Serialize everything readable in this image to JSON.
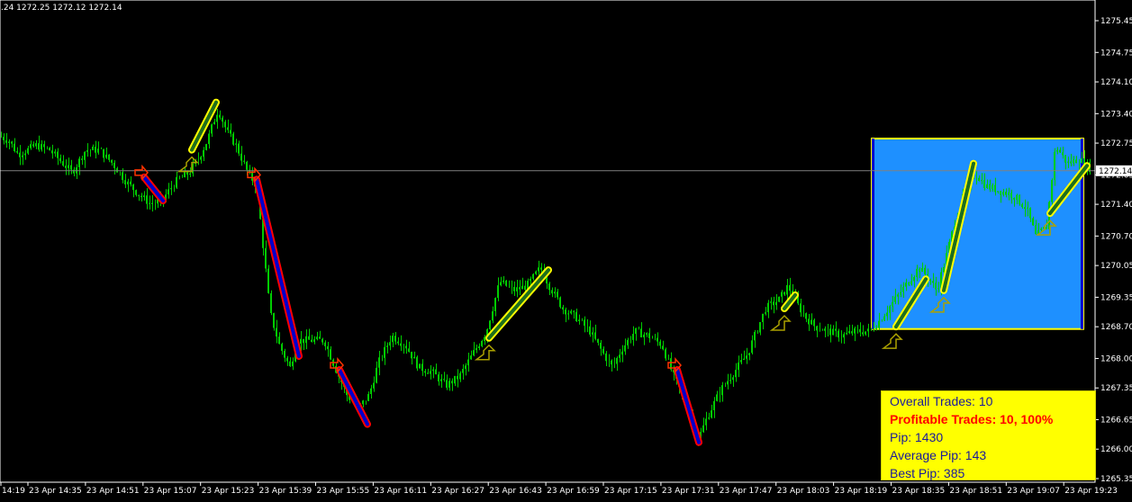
{
  "header": {
    "ohlc": ".24 1272.25 1272.12 1272.14"
  },
  "colors": {
    "background": "#000000",
    "candles": "#00cc00",
    "axis_text": "#ffffff",
    "price_line": "#808080",
    "buy_line": "#1e6e1e",
    "buy_outline": "#ffff00",
    "sell_line": "#0000cc",
    "sell_outline": "#ff0000",
    "highlight_box": "#1e90ff",
    "highlight_border": "#ffff00",
    "stats_bg": "#ffff00",
    "stats_text": "#1a1a9a",
    "stats_highlight": "#ff0000"
  },
  "current_price_label": "1272.14",
  "stats": {
    "overall": "Overall Trades: 10",
    "profitable": "Profitable Trades: 10, 100%",
    "pip": "Pip: 1430",
    "average": "Average Pip: 143",
    "best": "Best Pip: 385"
  },
  "chart_data": {
    "type": "candlestick",
    "y_ticks": [
      "1275.45",
      "1274.75",
      "1274.10",
      "1273.40",
      "1272.75",
      "1272.05",
      "1271.40",
      "1270.70",
      "1270.05",
      "1269.35",
      "1268.70",
      "1268.00",
      "1267.35",
      "1266.65",
      "1266.00",
      "1265.35"
    ],
    "x_ticks": [
      "14:19",
      "23 Apr 14:35",
      "23 Apr 14:51",
      "23 Apr 15:07",
      "23 Apr 15:23",
      "23 Apr 15:39",
      "23 Apr 15:55",
      "23 Apr 16:11",
      "23 Apr 16:27",
      "23 Apr 16:43",
      "23 Apr 16:59",
      "23 Apr 17:15",
      "23 Apr 17:31",
      "23 Apr 17:47",
      "23 Apr 18:03",
      "23 Apr 18:19",
      "23 Apr 18:35",
      "23 Apr 18:51",
      "23 Apr 19:07",
      "23 Apr 19:23"
    ],
    "ylim": [
      1265.25,
      1275.6
    ],
    "current_price": 1272.14,
    "price_path": [
      [
        0,
        1272.9
      ],
      [
        10,
        1272.8
      ],
      [
        20,
        1272.5
      ],
      [
        40,
        1272.7
      ],
      [
        55,
        1272.6
      ],
      [
        70,
        1272.3
      ],
      [
        80,
        1272.1
      ],
      [
        95,
        1272.6
      ],
      [
        110,
        1272.6
      ],
      [
        125,
        1272.3
      ],
      [
        140,
        1271.9
      ],
      [
        155,
        1271.6
      ],
      [
        168,
        1271.4
      ],
      [
        180,
        1271.5
      ],
      [
        195,
        1271.9
      ],
      [
        210,
        1272.1
      ],
      [
        220,
        1272.4
      ],
      [
        230,
        1272.8
      ],
      [
        242,
        1273.5
      ],
      [
        252,
        1273.0
      ],
      [
        262,
        1272.7
      ],
      [
        275,
        1272.1
      ],
      [
        285,
        1271.8
      ],
      [
        292,
        1270.5
      ],
      [
        300,
        1269.0
      ],
      [
        310,
        1268.3
      ],
      [
        322,
        1267.8
      ],
      [
        330,
        1268.4
      ],
      [
        345,
        1268.4
      ],
      [
        360,
        1268.4
      ],
      [
        372,
        1267.8
      ],
      [
        385,
        1267.2
      ],
      [
        398,
        1266.9
      ],
      [
        410,
        1267.2
      ],
      [
        420,
        1267.9
      ],
      [
        435,
        1268.5
      ],
      [
        450,
        1268.3
      ],
      [
        465,
        1267.8
      ],
      [
        480,
        1267.7
      ],
      [
        495,
        1267.4
      ],
      [
        510,
        1267.6
      ],
      [
        525,
        1268.1
      ],
      [
        540,
        1268.6
      ],
      [
        555,
        1269.7
      ],
      [
        570,
        1269.5
      ],
      [
        585,
        1269.6
      ],
      [
        600,
        1270.0
      ],
      [
        610,
        1269.6
      ],
      [
        625,
        1269.1
      ],
      [
        640,
        1268.9
      ],
      [
        655,
        1268.6
      ],
      [
        670,
        1268.1
      ],
      [
        680,
        1267.8
      ],
      [
        690,
        1268.2
      ],
      [
        705,
        1268.6
      ],
      [
        720,
        1268.5
      ],
      [
        735,
        1268.3
      ],
      [
        748,
        1267.6
      ],
      [
        760,
        1267.1
      ],
      [
        775,
        1266.2
      ],
      [
        785,
        1266.7
      ],
      [
        800,
        1267.3
      ],
      [
        815,
        1267.7
      ],
      [
        830,
        1268.1
      ],
      [
        840,
        1268.6
      ],
      [
        850,
        1269.1
      ],
      [
        865,
        1269.3
      ],
      [
        875,
        1269.6
      ],
      [
        885,
        1269.2
      ],
      [
        895,
        1268.9
      ],
      [
        905,
        1268.7
      ],
      [
        920,
        1268.6
      ],
      [
        935,
        1268.5
      ],
      [
        950,
        1268.6
      ],
      [
        965,
        1268.6
      ],
      [
        975,
        1268.8
      ],
      [
        990,
        1269.2
      ],
      [
        1005,
        1269.6
      ],
      [
        1020,
        1270.0
      ],
      [
        1030,
        1269.8
      ],
      [
        1040,
        1269.5
      ],
      [
        1050,
        1270.2
      ],
      [
        1060,
        1271.0
      ],
      [
        1070,
        1271.6
      ],
      [
        1082,
        1272.1
      ],
      [
        1095,
        1271.8
      ],
      [
        1110,
        1271.7
      ],
      [
        1125,
        1271.6
      ],
      [
        1140,
        1271.3
      ],
      [
        1150,
        1270.7
      ],
      [
        1162,
        1270.9
      ],
      [
        1172,
        1272.7
      ],
      [
        1185,
        1272.3
      ],
      [
        1198,
        1272.4
      ],
      [
        1210,
        1272.2
      ]
    ],
    "trades": [
      {
        "dir": "sell",
        "x0": 160,
        "p0": 1272.0,
        "x1": 181,
        "p1": 1271.48
      },
      {
        "dir": "buy",
        "x0": 213,
        "p0": 1272.6,
        "x1": 240,
        "p1": 1273.65
      },
      {
        "dir": "sell",
        "x0": 285,
        "p0": 1271.95,
        "x1": 332,
        "p1": 1268.05
      },
      {
        "dir": "sell",
        "x0": 377,
        "p0": 1267.75,
        "x1": 408,
        "p1": 1266.55
      },
      {
        "dir": "buy",
        "x0": 543,
        "p0": 1268.45,
        "x1": 609,
        "p1": 1269.95
      },
      {
        "dir": "sell",
        "x0": 752,
        "p0": 1267.75,
        "x1": 776,
        "p1": 1266.15
      },
      {
        "dir": "buy",
        "x0": 871,
        "p0": 1269.1,
        "x1": 883,
        "p1": 1269.4
      },
      {
        "dir": "buy",
        "x0": 995,
        "p0": 1268.7,
        "x1": 1028,
        "p1": 1269.75
      },
      {
        "dir": "buy",
        "x0": 1048,
        "p0": 1269.5,
        "x1": 1081,
        "p1": 1272.3
      },
      {
        "dir": "buy",
        "x0": 1166,
        "p0": 1271.2,
        "x1": 1207,
        "p1": 1272.25
      }
    ],
    "highlight": {
      "x0": 968,
      "x1": 1203,
      "top": 1272.85,
      "bottom": 1268.65
    }
  }
}
